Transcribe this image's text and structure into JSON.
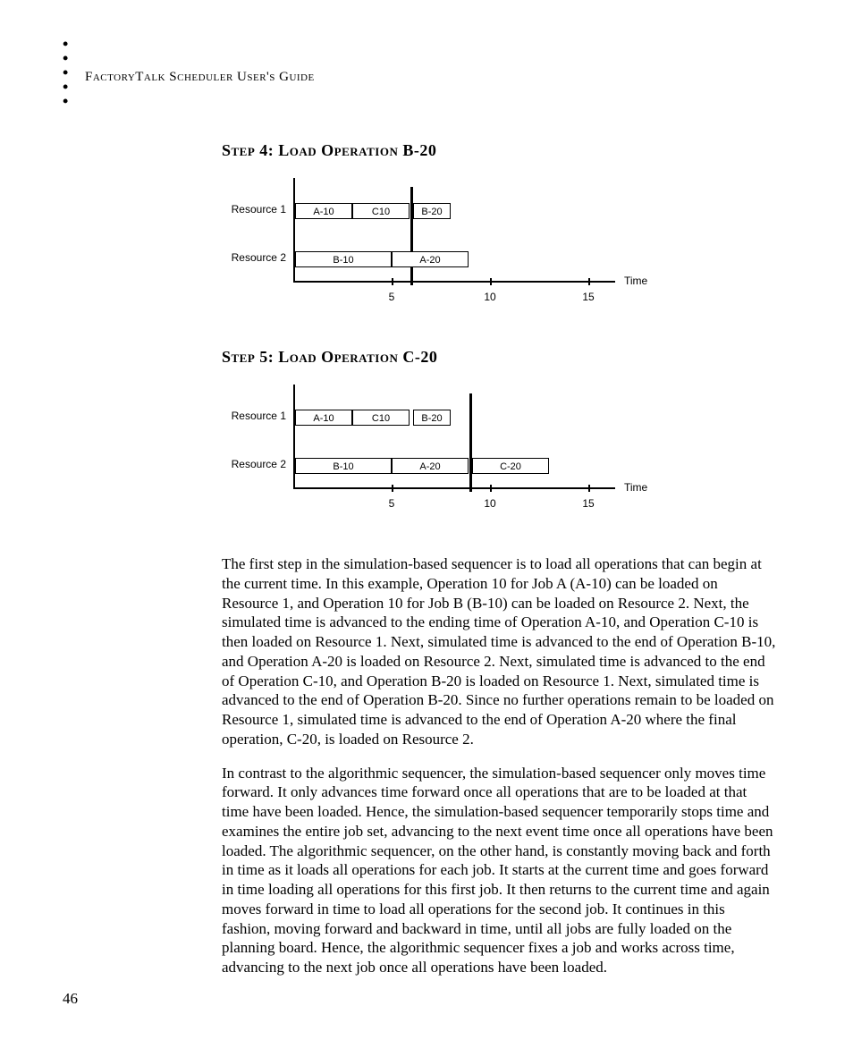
{
  "header": "FactoryTalk Scheduler User's Guide",
  "page_number": "46",
  "step4_title": "Step 4: Load Operation B-20",
  "step5_title": "Step 5: Load Operation C-20",
  "resource1_label": "Resource 1",
  "resource2_label": "Resource 2",
  "time_label": "Time",
  "para1": "The first step in the simulation-based sequencer is to load all operations that can begin at the current time. In this example, Operation 10 for Job A (A-10) can be loaded on Resource 1, and Operation 10 for Job B (B-10) can be loaded on Resource 2. Next, the simulated time is advanced to the ending time of Operation A-10, and Operation C-10 is then loaded on Resource 1. Next, simulated time is advanced to the end of Operation B-10, and Operation A-20 is loaded on Resource 2. Next, simulated time is advanced to the end of Operation C-10, and Operation B-20 is loaded on Resource 1. Next, simulated time is advanced to the end of Operation B-20. Since no further operations remain to be loaded on Resource 1, simulated time is advanced to the end of Operation A-20 where the final operation, C-20, is loaded on Resource 2.",
  "para2": "In contrast to the algorithmic sequencer, the simulation-based sequencer only moves time forward. It only advances time forward once all operations that are to be loaded at that time have been loaded. Hence, the simulation-based sequencer temporarily stops time and examines the entire job set, advancing to the next event time once all operations have been loaded. The algorithmic sequencer, on the other hand, is constantly moving back and forth in time as it loads all operations for each job. It starts at the current time and goes forward in time loading all operations for this first job. It then returns to the current time and again moves forward in time to load all operations for the second job. It continues in this fashion, moving forward and backward in time, until all jobs are fully loaded on the planning board. Hence, the algorithmic sequencer fixes a job and works across time, advancing to the next job once all operations have been loaded.",
  "chart_data": [
    {
      "step": "Step 4",
      "type": "gantt",
      "xlabel": "Time",
      "xlim": [
        0,
        15
      ],
      "ticks": [
        5,
        10,
        15
      ],
      "time_marker": 6,
      "rows": [
        {
          "name": "Resource 1",
          "ops": [
            {
              "label": "A-10",
              "start": 0,
              "end": 3
            },
            {
              "label": "C10",
              "start": 3,
              "end": 6
            },
            {
              "label": "B-20",
              "start": 6,
              "end": 8
            }
          ]
        },
        {
          "name": "Resource 2",
          "ops": [
            {
              "label": "B-10",
              "start": 0,
              "end": 5
            },
            {
              "label": "A-20",
              "start": 5,
              "end": 9
            }
          ]
        }
      ]
    },
    {
      "step": "Step 5",
      "type": "gantt",
      "xlabel": "Time",
      "xlim": [
        0,
        15
      ],
      "ticks": [
        5,
        10,
        15
      ],
      "time_marker": 9,
      "rows": [
        {
          "name": "Resource 1",
          "ops": [
            {
              "label": "A-10",
              "start": 0,
              "end": 3
            },
            {
              "label": "C10",
              "start": 3,
              "end": 6
            },
            {
              "label": "B-20",
              "start": 6,
              "end": 8
            }
          ]
        },
        {
          "name": "Resource 2",
          "ops": [
            {
              "label": "B-10",
              "start": 0,
              "end": 5
            },
            {
              "label": "A-20",
              "start": 5,
              "end": 9
            },
            {
              "label": "C-20",
              "start": 9,
              "end": 13
            }
          ]
        }
      ]
    }
  ]
}
